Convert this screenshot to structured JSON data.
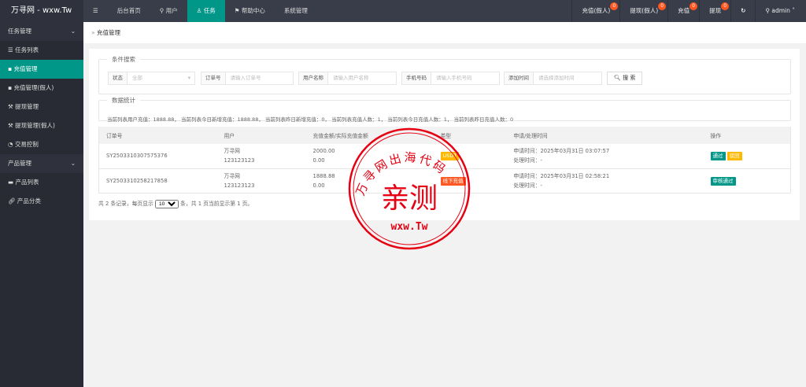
{
  "header": {
    "logo": "万寻网 - wxw.Tw",
    "menu_icon": "☰",
    "nav": [
      "后台首页",
      "用户",
      "任务",
      "帮助中心",
      "系统管理"
    ],
    "right": [
      {
        "label": "充值(假人)",
        "count": "0"
      },
      {
        "label": "提现(假人)",
        "count": "0"
      },
      {
        "label": "充值",
        "count": "0"
      },
      {
        "label": "提现",
        "count": "0"
      }
    ],
    "refresh": "↻",
    "user": "admin"
  },
  "sidebar": {
    "group1": "任务管理",
    "items1": [
      "任务列表",
      "充值管理",
      "充值管理(假人)",
      "提现管理",
      "提现管理(假人)",
      "交易控制"
    ],
    "group2": "产品管理",
    "items2": [
      "产品列表",
      "产品分类"
    ]
  },
  "breadcrumb": "充值管理",
  "search": {
    "legend": "条件搜索",
    "status_label": "状态",
    "status_value": "全部",
    "order_label": "订单号",
    "order_ph": "请输入订单号",
    "user_label": "用户名称",
    "user_ph": "请输入用户名称",
    "phone_label": "手机号码",
    "phone_ph": "请输入手机号码",
    "time_label": "添加时间",
    "time_ph": "请选择添加时间",
    "button": "搜 索"
  },
  "stats": {
    "legend": "数据统计",
    "text": "当前列表用户充值：1888.88， 当前列表今日新增充值：1888.88， 当前列表昨日新增充值：0， 当前列表充值人数：1， 当前列表今日充值人数：1， 当前列表昨日充值人数：0"
  },
  "table": {
    "headers": [
      "订单号",
      "用户",
      "充值金额/实际充值金额",
      "类型",
      "申请/处理时间",
      "操作"
    ],
    "rows": [
      {
        "order": "SY2503310307575376",
        "user": "万寻网",
        "phone": "123123123",
        "amount": "2000.00",
        "actual": "0.00",
        "type": "USDT",
        "apply": "申请时间：2025年03月31日 03:07:57",
        "process": "处理时间：-",
        "actions": [
          "通过",
          "驳回"
        ]
      },
      {
        "order": "SY2503310258217858",
        "user": "万寻网",
        "phone": "123123123",
        "amount": "1888.88",
        "actual": "0.00",
        "type": "线下充值",
        "apply": "申请时间：2025年03月31日 02:58:21",
        "process": "处理时间：-",
        "actions": [
          "审核通过"
        ]
      }
    ]
  },
  "pagination": {
    "prefix": "共 2 条记录，每页显示",
    "size": "10",
    "suffix": "条，共 1 页当前显示第 1 页。"
  },
  "watermark": {
    "top": "万寻网出海代码",
    "center": "亲测",
    "bottom": "wxw.Tw"
  },
  "colors": {
    "accent": "#009688",
    "warn": "#ffb800",
    "danger": "#ff5722"
  }
}
